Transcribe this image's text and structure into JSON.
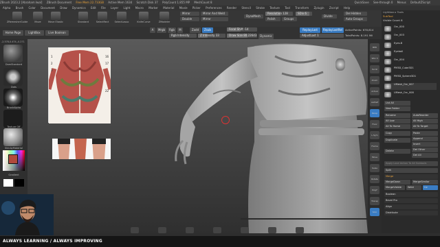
{
  "titlebar": {
    "app": "ZBrush 2023.2 [Abraham Iwal]",
    "doc": "ZBrush Document",
    "free_mem": "Free Mem 22.733GB",
    "active_mem": "Active Mem 1634",
    "scratch": "Scratch Disk 37",
    "poly": "PolyCount 1.855 MP",
    "mesh": "MeshCount 8",
    "quicksave": "QuickSave",
    "see_through": "See-through 0",
    "menus": "Menus",
    "default_script": "DefaultZScript"
  },
  "menu": [
    "Alpha",
    "Brush",
    "Color",
    "Document",
    "Draw",
    "Dynamics",
    "Edit",
    "File",
    "Layer",
    "Light",
    "Macro",
    "Marker",
    "Material",
    "Movie",
    "Picker",
    "Preferences",
    "Render",
    "Stencil",
    "Stroke",
    "Texture",
    "Tool",
    "Transform",
    "Zplugin",
    "Zscript",
    "Help"
  ],
  "shelf": {
    "tools": [
      "ZRemesherGuide",
      "Move",
      "Move Elastic",
      "Standard",
      "SelectRect",
      "SelectLasso",
      "KnifeCurve",
      "ZModeler"
    ],
    "mirror1": "Mirror",
    "mirror_weld": "Mirror And Weld",
    "double": "Double",
    "mirror2": "Mirror",
    "dynamesh": "DynaMesh",
    "resolution": "Resolution 128",
    "sdiv": "SDiv 6",
    "polish": "Polish",
    "groups": "Groups",
    "divide": "Divide",
    "del_hidden": "Del Hidden",
    "auto_groups": "Auto Groups"
  },
  "row2": {
    "home": "Home Page",
    "lightbox": "LightBox",
    "live_boolean": "Live Boolean",
    "a": "A",
    "mrgb": "Mrgb",
    "rgb": "Rgb",
    "m": "M",
    "zadd": "Zadd",
    "zsub": "Zsub",
    "rgb_int": "Rgb Intensity",
    "z_int": "Z Intensity 33",
    "focal": "Focal Shift -14",
    "draw_size": "Draw Size 80.22643",
    "dynamic": "Dynamic",
    "replay_last": "ReplayLast",
    "replay_last_rel": "ReplayLastRel",
    "adjust": "AdjustLast 1",
    "active_points": "ActivePoints: 678,814",
    "total_points": "TotalPoints: 8.191 Mil"
  },
  "left": {
    "coords": "-2.578,0.474,-0.271",
    "brush_label": "DamStandard",
    "dots_label": "Dots",
    "alpha_label": "BrushAlpha",
    "texture_label": "Texture Off",
    "material_label": "SkinAyMaterial",
    "gradient_label": "Gradient",
    "main_color": "#b04a3c"
  },
  "nav": [
    "BPR",
    "SPix 3",
    "Scroll",
    "Zoom",
    "Actual",
    "AAHalf",
    "Persp",
    "Floor",
    "L.Sym",
    "Frame",
    "Move",
    "Scale",
    "Rotate",
    "PolyF",
    "Transp",
    "Solo"
  ],
  "right": {
    "top": "Lightbox ▸ Tools",
    "subtool_label": "SubTool",
    "visible_count": "Visible Count 8",
    "subtools": [
      "Orc_000",
      "Orc_003",
      "Eyes-B",
      "Eyeball",
      "Orc_004",
      "PM3D_Cube3D1",
      "PM3D_Sphere3D1",
      "UMesh_Orc_007",
      "UMesh_Orc_008"
    ],
    "list_all": "List All",
    "new_folder": "New Folder",
    "rename": "Rename",
    "autoreorder": "AutoReorder",
    "all_low": "All Low",
    "all_high": "All High",
    "all_to_home": "All To Home",
    "all_to_target": "All To Target",
    "copy": "Copy",
    "paste": "Paste",
    "duplicate": "Duplicate",
    "append": "Append",
    "insert": "Insert",
    "delete": "Delete",
    "del_other": "Del Other",
    "del_all": "Del All",
    "apply": "Apply Love Action To All Subtools",
    "split": "Split",
    "merge": "Merge",
    "merge_down": "MergeDown",
    "merge_similar": "MergeSimilar",
    "merge_visible": "MergeVisible",
    "weld": "Weld",
    "uv": "Uv",
    "boolean": "Boolean",
    "bevel_pro": "Bevel Pro",
    "align": "Align",
    "distribute": "Distribute"
  },
  "banner": "ALWAYS LEARNING  / ALWAYS IMPROVING"
}
